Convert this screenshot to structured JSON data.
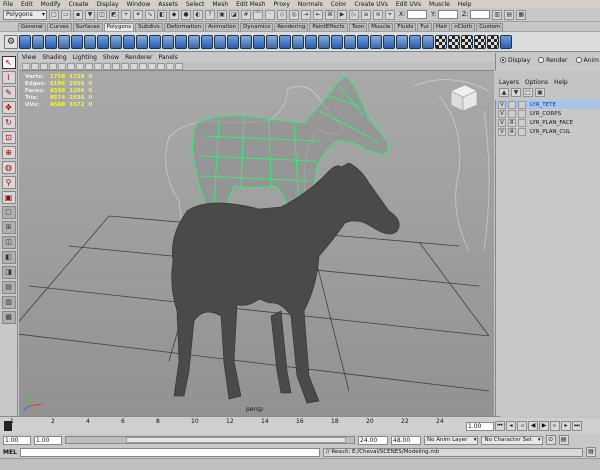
{
  "menubar": [
    "File",
    "Edit",
    "Modify",
    "Create",
    "Display",
    "Window",
    "Assets",
    "Select",
    "Mesh",
    "Edit Mesh",
    "Proxy",
    "Normals",
    "Color",
    "Create UVs",
    "Edit UVs",
    "Muscle",
    "Help"
  ],
  "status": {
    "mode": "Polygons",
    "x_label": "X:",
    "y_label": "Y:",
    "z_label": "Z:"
  },
  "shelf_tabs": [
    "General",
    "Curves",
    "Surfaces",
    "Polygons",
    "Subdivs",
    "Deformation",
    "Animation",
    "Dynamics",
    "Rendering",
    "PaintEffects",
    "Toon",
    "Muscle",
    "Fluids",
    "Fur",
    "Hair",
    "nCloth",
    "Custom"
  ],
  "shelf_active": "Polygons",
  "panel_menu": [
    "View",
    "Shading",
    "Lighting",
    "Show",
    "Renderer",
    "Panels"
  ],
  "hud": {
    "rows": [
      {
        "label": "Verts:",
        "a": "1758",
        "b": "1728",
        "c": "0"
      },
      {
        "label": "Edges:",
        "a": "6196",
        "b": "2956",
        "c": "0"
      },
      {
        "label": "Faces:",
        "a": "4338",
        "b": "1266",
        "c": "0"
      },
      {
        "label": "Tris:",
        "a": "8574",
        "b": "2536",
        "c": "0"
      },
      {
        "label": "UVs:",
        "a": "4588",
        "b": "1572",
        "c": "0"
      }
    ]
  },
  "viewport": {
    "camera": "persp",
    "bg_top": "#a9a9a9",
    "bg_bottom": "#929292",
    "wire_color": "#33ee77",
    "mesh_color": "#4a4a4a"
  },
  "channel_box": {
    "modes": [
      "Display",
      "Render",
      "Anim"
    ],
    "mode_selected": "Display",
    "menu": [
      "Layers",
      "Options",
      "Help"
    ],
    "layers": [
      {
        "v": "V",
        "p": "",
        "name": "LYR_TETE",
        "selected": true
      },
      {
        "v": "V",
        "p": "",
        "name": "LYR_CORPS",
        "selected": false
      },
      {
        "v": "V",
        "p": "R",
        "name": "LYR_PLAN_FACE",
        "selected": false
      },
      {
        "v": "V",
        "p": "R",
        "name": "LYR_PLAN_CUL",
        "selected": false
      }
    ]
  },
  "timeline": {
    "ticks": [
      "1",
      "2",
      "4",
      "6",
      "8",
      "10",
      "12",
      "14",
      "16",
      "18",
      "20",
      "22",
      "24"
    ],
    "current_frame": "1.00"
  },
  "range": {
    "start": "1.00",
    "inner_start": "1.00",
    "inner_end": "24.00",
    "end": "48.00",
    "anim_layer": "No Anim Layer",
    "character_set": "No Character Set"
  },
  "command": {
    "label": "MEL",
    "result": "// Result: E:/Cheval/SCENES/Modeling.mb"
  }
}
